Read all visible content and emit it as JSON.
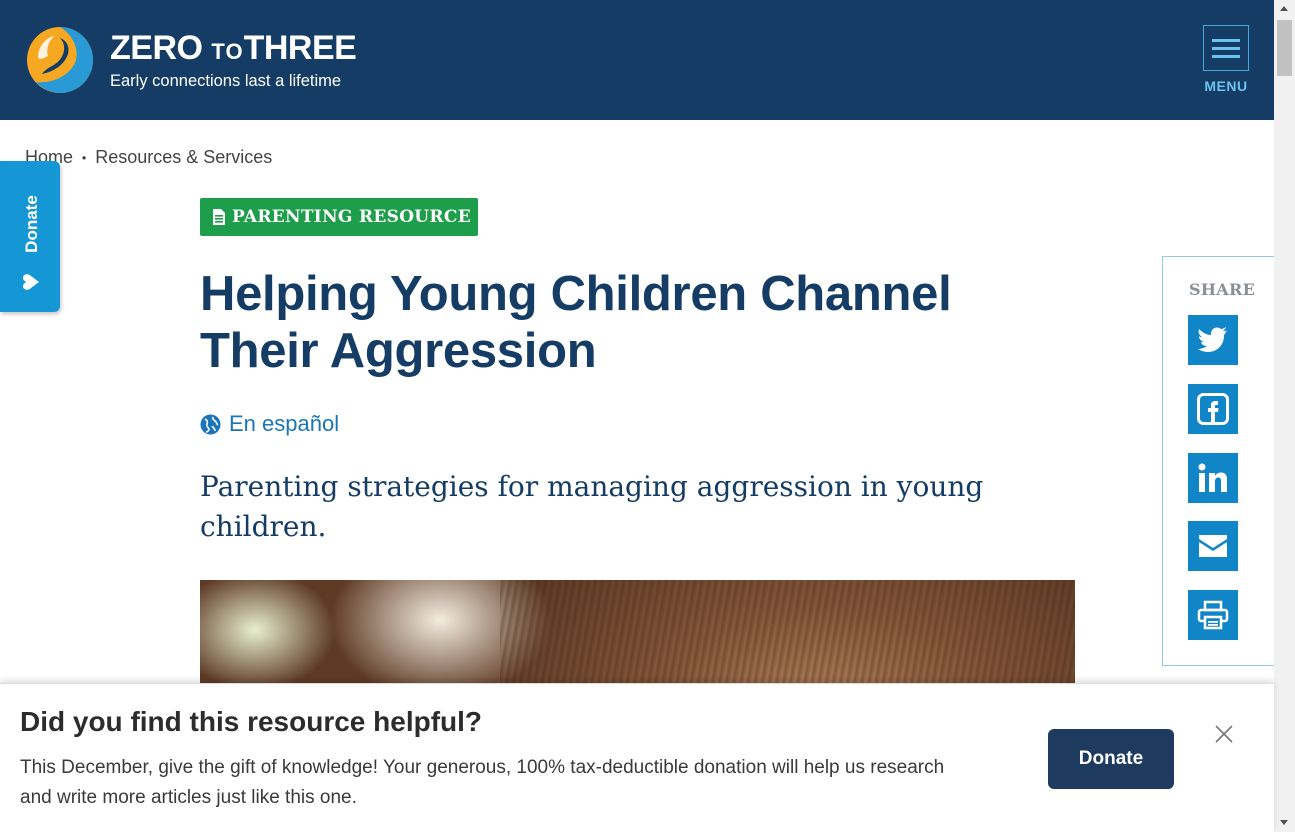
{
  "header": {
    "brand_name_part1": "ZERO",
    "brand_name_part2": "TO",
    "brand_name_part3": "THREE",
    "tagline": "Early connections last a lifetime",
    "menu_label": "MENU"
  },
  "breadcrumb": {
    "items": [
      {
        "label": "Home"
      },
      {
        "label": "Resources & Services"
      }
    ],
    "separator": "•"
  },
  "donate_tab": {
    "label": "Donate"
  },
  "article": {
    "badge": "PARENTING RESOURCE",
    "title": "Helping Young Children Channel Their Aggression",
    "language_link": "En español",
    "subtitle": "Parenting strategies for managing aggression in young children."
  },
  "share": {
    "label": "SHARE",
    "buttons": [
      "twitter-icon",
      "facebook-icon",
      "linkedin-icon",
      "email-icon",
      "print-icon"
    ]
  },
  "banner": {
    "title": "Did you find this resource helpful?",
    "text": "This December, give the gift of knowledge! Your generous, 100% tax-deductible donation will help us research and write more articles just like this one.",
    "donate_label": "Donate"
  },
  "colors": {
    "header_bg": "#153c64",
    "accent_blue": "#1085c8",
    "badge_green": "#1e9e4a",
    "title_navy": "#153c64",
    "donate_button": "#1f3a5f"
  }
}
